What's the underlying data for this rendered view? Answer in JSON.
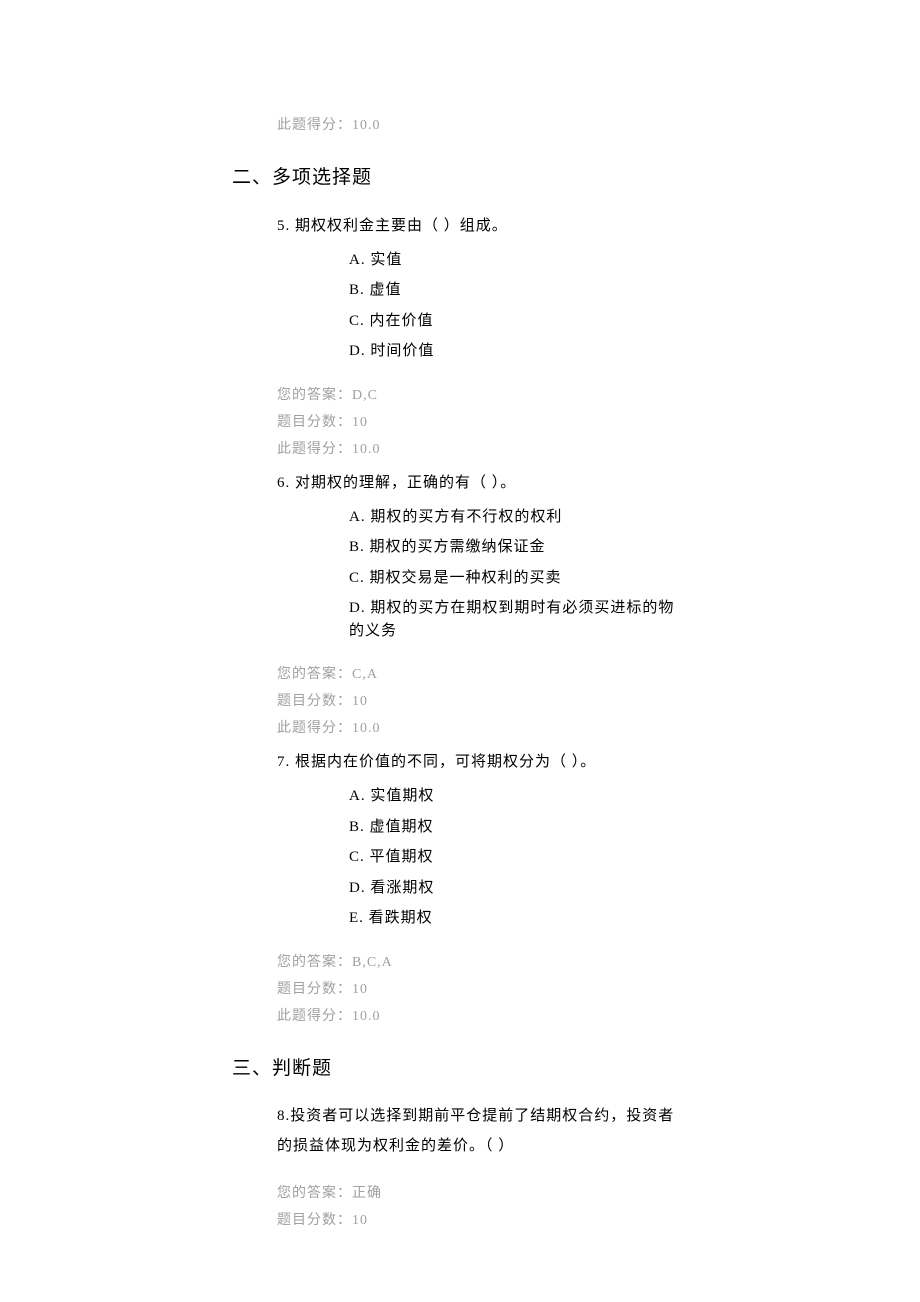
{
  "top_score": "此题得分：10.0",
  "section2": {
    "title": "二、多项选择题",
    "q5": {
      "stem": "5. 期权权利金主要由（ ）组成。",
      "A": "A. 实值",
      "B": "B. 虚值",
      "C": "C. 内在价值",
      "D": "D. 时间价值",
      "answer": "您的答案：D,C",
      "full": "题目分数：10",
      "got": "此题得分：10.0"
    },
    "q6": {
      "stem": "6. 对期权的理解，正确的有（ ）。",
      "A": "A. 期权的买方有不行权的权利",
      "B": "B. 期权的买方需缴纳保证金",
      "C": "C. 期权交易是一种权利的买卖",
      "D": "D. 期权的买方在期权到期时有必须买进标的物的义务",
      "answer": "您的答案：C,A",
      "full": "题目分数：10",
      "got": "此题得分：10.0"
    },
    "q7": {
      "stem": "7. 根据内在价值的不同，可将期权分为（ ）。",
      "A": "A. 实值期权",
      "B": "B. 虚值期权",
      "C": "C. 平值期权",
      "D": "D. 看涨期权",
      "E": "E. 看跌期权",
      "answer": "您的答案：B,C,A",
      "full": "题目分数：10",
      "got": "此题得分：10.0"
    }
  },
  "section3": {
    "title": "三、判断题",
    "q8": {
      "stem": "8.投资者可以选择到期前平仓提前了结期权合约，投资者的损益体现为权利金的差价。（ ）",
      "answer": "您的答案：正确",
      "full": "题目分数：10"
    }
  }
}
